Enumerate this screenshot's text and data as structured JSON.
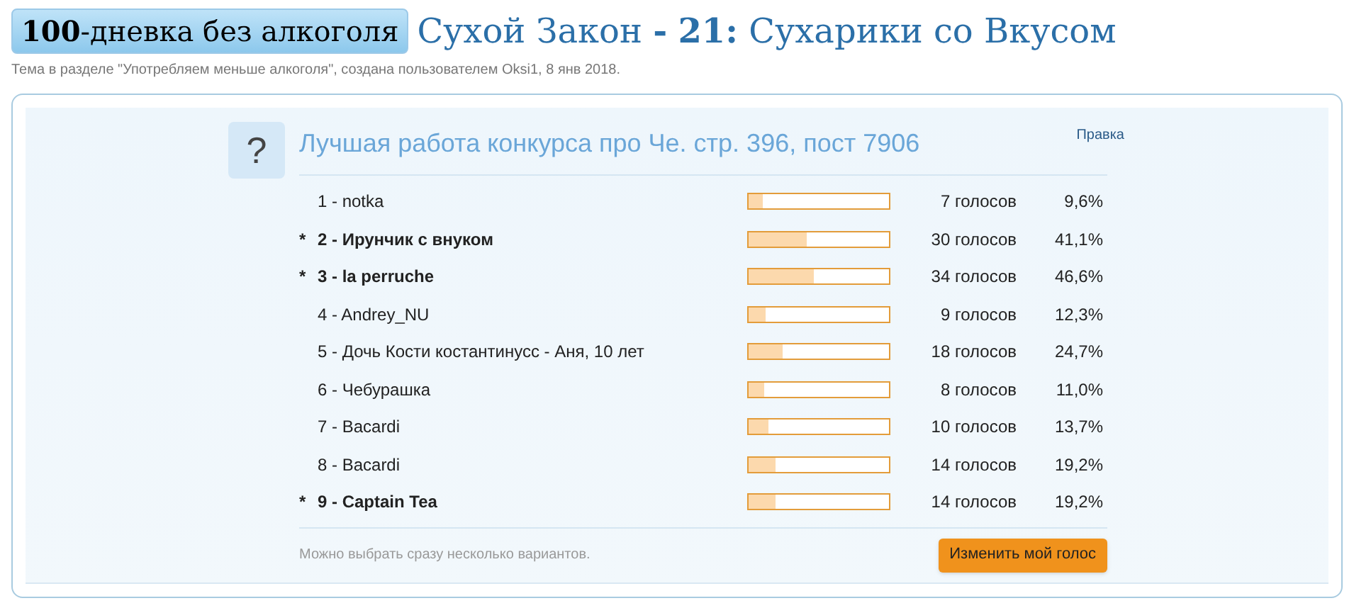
{
  "header": {
    "prefix": "**100**-дневка без алкоголя",
    "title": "Сухой Закон **-** **21:** Сухарики со Вкусом",
    "subtitle": "Тема в разделе \"Употребляем меньше алкоголя\", создана пользователем Oksi1, 8 янв 2018."
  },
  "poll": {
    "icon": "?",
    "question": "Лучшая работа конкурса про Че. стр. 396, пост 7906",
    "edit_link": "Правка",
    "options": [
      {
        "label": "1 - notka",
        "voted": false,
        "level": 0.096,
        "votes": "7 голосов",
        "percent": "9,6%"
      },
      {
        "marker": "*",
        "label": "2 - Ирунчик с внуком",
        "voted": true,
        "level": 0.411,
        "votes": "30 голосов",
        "percent": "41,1%"
      },
      {
        "marker": "*",
        "label": "3 - la perruche",
        "voted": true,
        "level": 0.466,
        "votes": "34 голосов",
        "percent": "46,6%"
      },
      {
        "label": "4 - Andrey_NU",
        "voted": false,
        "level": 0.123,
        "votes": "9 голосов",
        "percent": "12,3%"
      },
      {
        "label": "5 - Дочь Кости костантинусс - Аня, 10 лет",
        "voted": false,
        "level": 0.247,
        "votes": "18 голосов",
        "percent": "24,7%"
      },
      {
        "label": "6 - Чебурашка",
        "voted": false,
        "level": 0.11,
        "votes": "8 голосов",
        "percent": "11,0%"
      },
      {
        "label": "7 - Bacardi",
        "voted": false,
        "level": 0.137,
        "votes": "10 голосов",
        "percent": "13,7%"
      },
      {
        "label": "8 - Bacardi",
        "voted": false,
        "level": 0.192,
        "votes": "14 голосов",
        "percent": "19,2%"
      },
      {
        "marker": "*",
        "label": "9 - Captain Tea",
        "voted": true,
        "level": 0.192,
        "votes": "14 голосов",
        "percent": "19,2%"
      }
    ],
    "note": "Можно выбрать сразу несколько вариантов.",
    "button": "Изменить мой голос"
  }
}
